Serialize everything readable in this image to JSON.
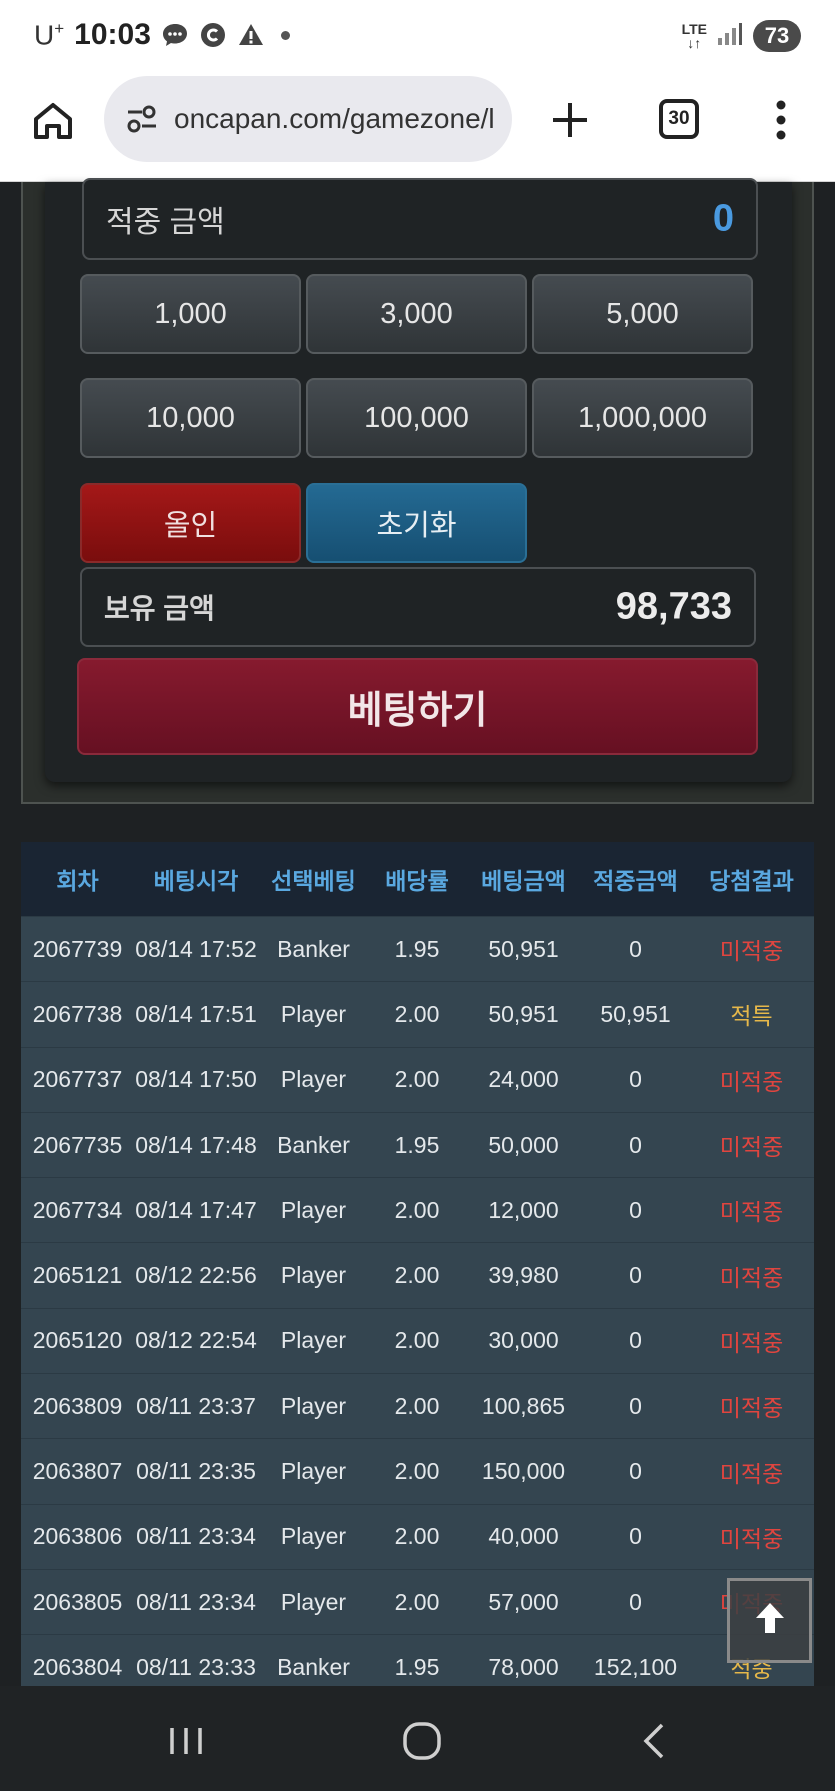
{
  "status_bar": {
    "carrier": "U",
    "carrier_sup": "+",
    "time": "10:03",
    "network": "LTE",
    "battery": "73",
    "icons": [
      "chat-bubble-icon",
      "c-badge-icon",
      "warning-icon",
      "dot-icon",
      "lte-icon",
      "signal-icon"
    ]
  },
  "browser": {
    "url": "oncapan.com/gamezone/l",
    "tab_count": "30",
    "icons": [
      "home-icon",
      "site-settings-icon",
      "plus-icon",
      "tab-switcher-icon",
      "more-vert-icon"
    ]
  },
  "bet_panel": {
    "win_amount_label": "적중 금액",
    "win_amount_value": "0",
    "amount_buttons": [
      "1,000",
      "3,000",
      "5,000",
      "10,000",
      "100,000",
      "1,000,000"
    ],
    "allin_label": "올인",
    "reset_label": "초기화",
    "balance_label": "보유 금액",
    "balance_value": "98,733",
    "bet_button_label": "베팅하기",
    "colors": {
      "win_amount": "#4a9ae0",
      "allin": "#a41818",
      "reset": "#246a93",
      "bet": "#861a2e"
    }
  },
  "history": {
    "headers": [
      "회차",
      "베팅시각",
      "선택베팅",
      "배당률",
      "베팅금액",
      "적중금액",
      "당첨결과"
    ],
    "rows": [
      [
        "2067739",
        "08/14 17:52",
        "Banker",
        "1.95",
        "50,951",
        "0",
        "미적중"
      ],
      [
        "2067738",
        "08/14 17:51",
        "Player",
        "2.00",
        "50,951",
        "50,951",
        "적특"
      ],
      [
        "2067737",
        "08/14 17:50",
        "Player",
        "2.00",
        "24,000",
        "0",
        "미적중"
      ],
      [
        "2067735",
        "08/14 17:48",
        "Banker",
        "1.95",
        "50,000",
        "0",
        "미적중"
      ],
      [
        "2067734",
        "08/14 17:47",
        "Player",
        "2.00",
        "12,000",
        "0",
        "미적중"
      ],
      [
        "2065121",
        "08/12 22:56",
        "Player",
        "2.00",
        "39,980",
        "0",
        "미적중"
      ],
      [
        "2065120",
        "08/12 22:54",
        "Player",
        "2.00",
        "30,000",
        "0",
        "미적중"
      ],
      [
        "2063809",
        "08/11 23:37",
        "Player",
        "2.00",
        "100,865",
        "0",
        "미적중"
      ],
      [
        "2063807",
        "08/11 23:35",
        "Player",
        "2.00",
        "150,000",
        "0",
        "미적중"
      ],
      [
        "2063806",
        "08/11 23:34",
        "Player",
        "2.00",
        "40,000",
        "0",
        "미적중"
      ],
      [
        "2063805",
        "08/11 23:34",
        "Player",
        "2.00",
        "57,000",
        "0",
        "미적중"
      ],
      [
        "2063804",
        "08/11 23:33",
        "Banker",
        "1.95",
        "78,000",
        "152,100",
        "적중"
      ]
    ],
    "result_colors": {
      "미적중": "#e0453f",
      "적특": "#e6b84a",
      "적중": "#e6b84a"
    }
  },
  "scroll_top": {
    "icon": "arrow-up-icon"
  },
  "nav_bar": {
    "icons": [
      "recents-icon",
      "home-circle-icon",
      "back-icon"
    ]
  }
}
